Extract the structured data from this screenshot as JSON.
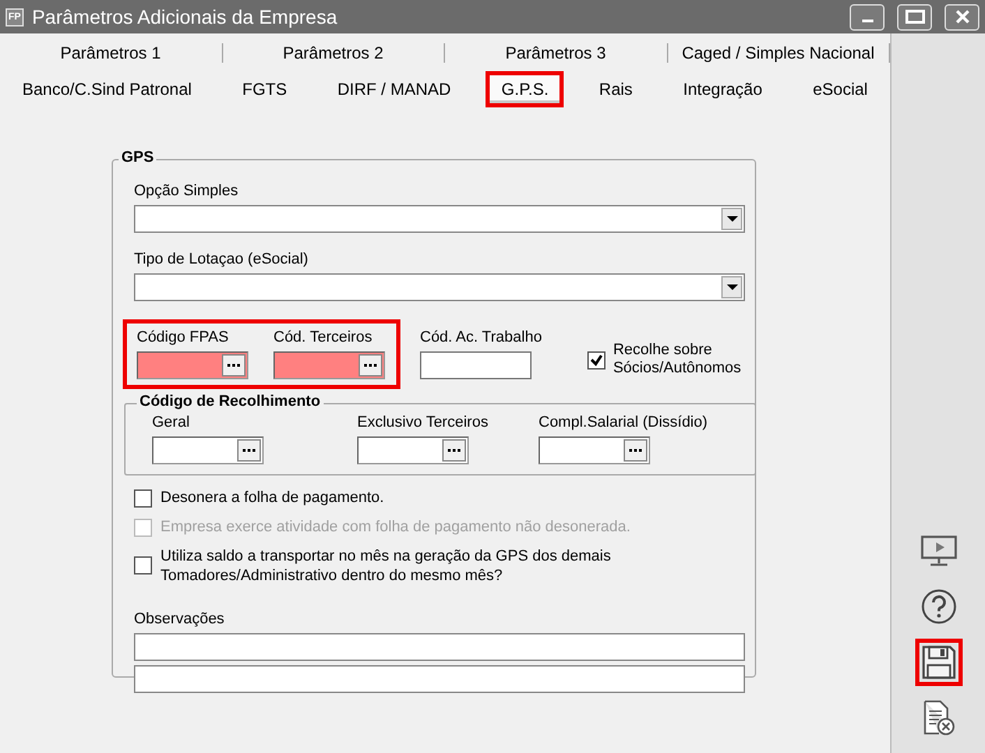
{
  "window": {
    "title": "Parâmetros Adicionais da Empresa",
    "app_badge": "FP"
  },
  "tab_rows": [
    [
      {
        "label": "Parâmetros 1",
        "selected": false,
        "highlighted": false
      },
      {
        "label": "Parâmetros 2",
        "selected": false,
        "highlighted": false
      },
      {
        "label": "Parâmetros 3",
        "selected": false,
        "highlighted": false
      },
      {
        "label": "Caged / Simples Nacional",
        "selected": false,
        "highlighted": false
      }
    ],
    [
      {
        "label": "Banco/C.Sind Patronal",
        "selected": false,
        "highlighted": false
      },
      {
        "label": "FGTS",
        "selected": false,
        "highlighted": false
      },
      {
        "label": "DIRF / MANAD",
        "selected": false,
        "highlighted": false
      },
      {
        "label": "G.P.S.",
        "selected": true,
        "highlighted": true
      },
      {
        "label": "Rais",
        "selected": false,
        "highlighted": false
      },
      {
        "label": "Integração",
        "selected": false,
        "highlighted": false
      },
      {
        "label": "eSocial",
        "selected": false,
        "highlighted": false
      }
    ]
  ],
  "gps": {
    "title": "GPS",
    "selects": [
      {
        "label": "Opção Simples"
      },
      {
        "label": "Tipo de Lotaçao (eSocial)"
      }
    ],
    "code_group": {
      "highlighted": true,
      "fields": [
        {
          "label": "Código FPAS",
          "invalid": true
        },
        {
          "label": "Cód. Terceiros",
          "invalid": true
        }
      ]
    },
    "ac_trabalho": {
      "label": "Cód. Ac. Trabalho"
    },
    "recolhe": {
      "label": "Recolhe sobre Sócios/Autônomos",
      "checked": true
    },
    "recolhimento": {
      "title": "Código de Recolhimento",
      "fields": [
        {
          "label": "Geral",
          "invalid": false
        },
        {
          "label": "Exclusivo Terceiros",
          "invalid": false
        },
        {
          "label": "Compl.Salarial (Dissídio)",
          "invalid": false
        }
      ]
    },
    "checks": [
      {
        "label": "Desonera a folha de pagamento.",
        "checked": false,
        "disabled": false
      },
      {
        "label": "Empresa exerce atividade com folha de pagamento não desonerada.",
        "checked": false,
        "disabled": true
      },
      {
        "label": "Utiliza saldo a transportar no mês na geração da GPS dos demais Tomadores/Administrativo dentro do mesmo mês?",
        "checked": false,
        "disabled": false
      }
    ],
    "observacoes": {
      "label": "Observações"
    }
  },
  "tools": [
    {
      "kind": "monitor",
      "highlighted": false
    },
    {
      "kind": "help",
      "highlighted": false
    },
    {
      "kind": "save",
      "highlighted": true
    },
    {
      "kind": "cancel",
      "highlighted": false
    }
  ]
}
